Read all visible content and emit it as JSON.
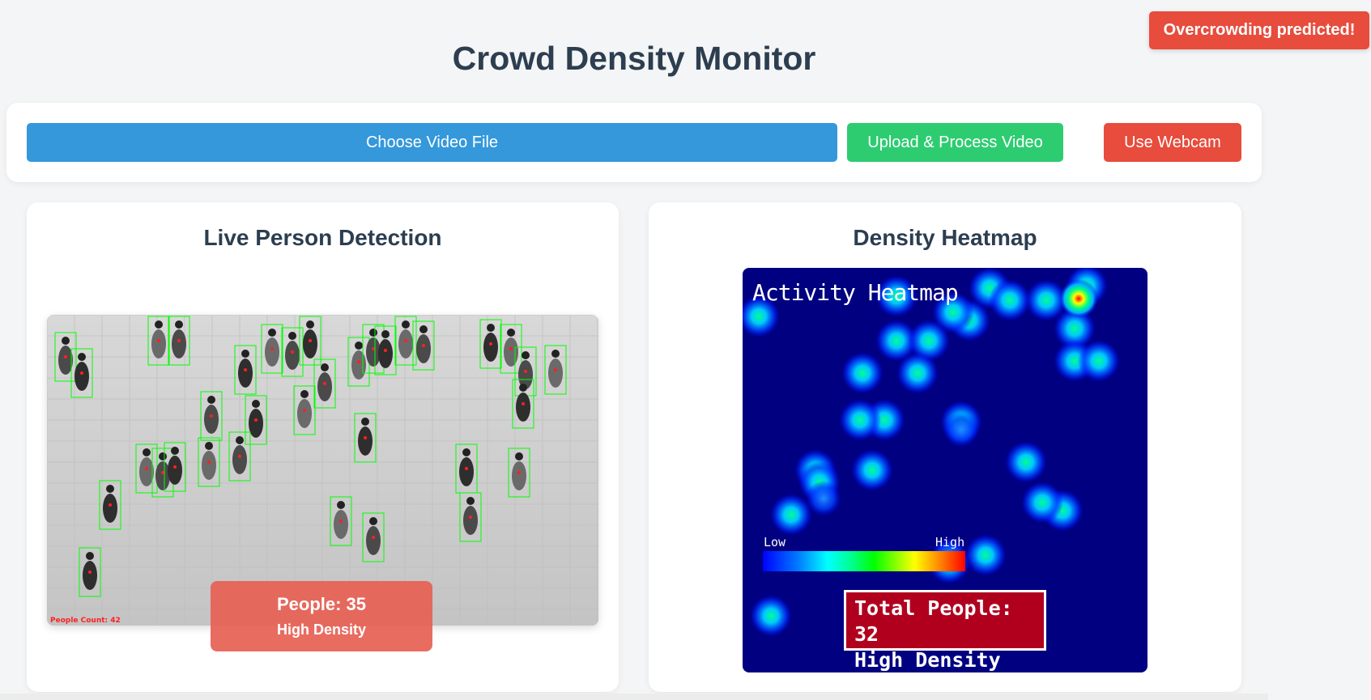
{
  "alert": {
    "text": "Overcrowding predicted!"
  },
  "header": {
    "title": "Crowd Density Monitor"
  },
  "toolbar": {
    "choose_label": "Choose Video File",
    "upload_label": "Upload & Process Video",
    "webcam_label": "Use Webcam"
  },
  "detection_panel": {
    "title": "Live Person Detection",
    "people_count_label": "People: 35",
    "density_label": "High Density",
    "video_overlay_count": "People Count: 42"
  },
  "heatmap_panel": {
    "title": "Density Heatmap",
    "image_title": "Activity Heatmap",
    "legend_low": "Low",
    "legend_high": "High",
    "total_label": "Total People: 32",
    "density_label": "High Density"
  },
  "colors": {
    "alert": "#e74c3c",
    "choose_button": "#3498db",
    "upload_button": "#2ecc71",
    "webcam_button": "#e74c3c",
    "heatmap_bg": "#000080",
    "detection_box": "#00ff00"
  }
}
